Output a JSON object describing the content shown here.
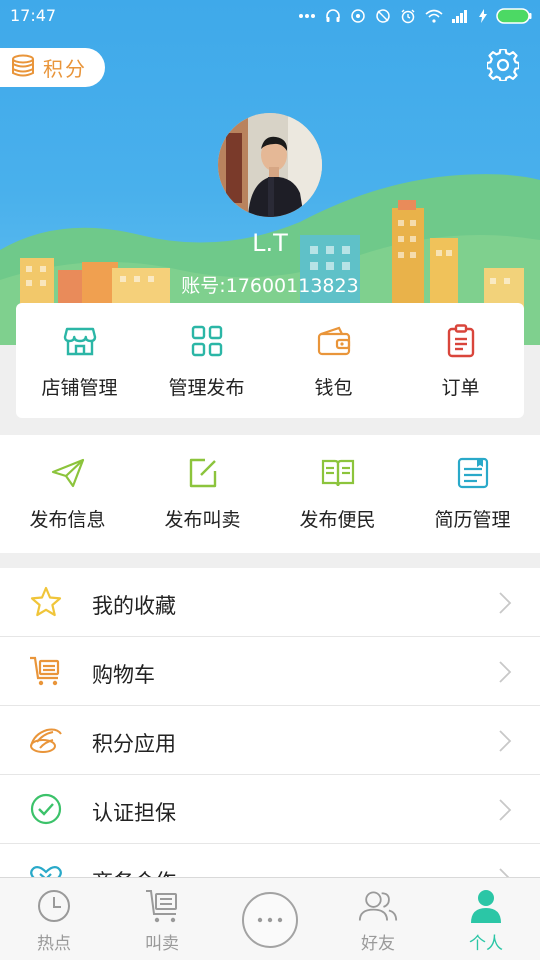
{
  "status_bar": {
    "time": "17:47",
    "icons": [
      "more-dots-icon",
      "headphones-icon",
      "location-icon",
      "dnd-icon",
      "alarm-icon",
      "wifi-icon",
      "signal-icon",
      "charging-icon",
      "battery-icon"
    ]
  },
  "header": {
    "points_label": "积分",
    "username": "L.T",
    "account_prefix": "账号:",
    "account_number": "17600113823"
  },
  "store_menu": [
    {
      "label": "店铺管理",
      "icon": "store-icon",
      "color": "#2bb6a6"
    },
    {
      "label": "管理发布",
      "icon": "grid-icon",
      "color": "#2bb6a6"
    },
    {
      "label": "钱包",
      "icon": "wallet-icon",
      "color": "#e9953a"
    },
    {
      "label": "订单",
      "icon": "clipboard-icon",
      "color": "#d9453b"
    }
  ],
  "publish_menu": [
    {
      "label": "发布信息",
      "icon": "paper-plane-icon",
      "color": "#8cc43c"
    },
    {
      "label": "发布叫卖",
      "icon": "edit-icon",
      "color": "#8cc43c"
    },
    {
      "label": "发布便民",
      "icon": "book-icon",
      "color": "#8cc43c"
    },
    {
      "label": "简历管理",
      "icon": "resume-icon",
      "color": "#29a9c9"
    }
  ],
  "list": [
    {
      "label": "我的收藏",
      "icon": "star-icon",
      "color": "#f0c53a"
    },
    {
      "label": "购物车",
      "icon": "cart-icon",
      "color": "#e9953a"
    },
    {
      "label": "积分应用",
      "icon": "coins-icon",
      "color": "#e9953a"
    },
    {
      "label": "认证担保",
      "icon": "check-circle-icon",
      "color": "#3cc26a"
    },
    {
      "label": "商务合作",
      "icon": "handshake-icon",
      "color": "#29a9c9"
    }
  ],
  "bottom_nav": {
    "hot": "热点",
    "sell": "叫卖",
    "friends": "好友",
    "me": "个人",
    "active": "个人",
    "active_color": "#2bc6a6"
  }
}
